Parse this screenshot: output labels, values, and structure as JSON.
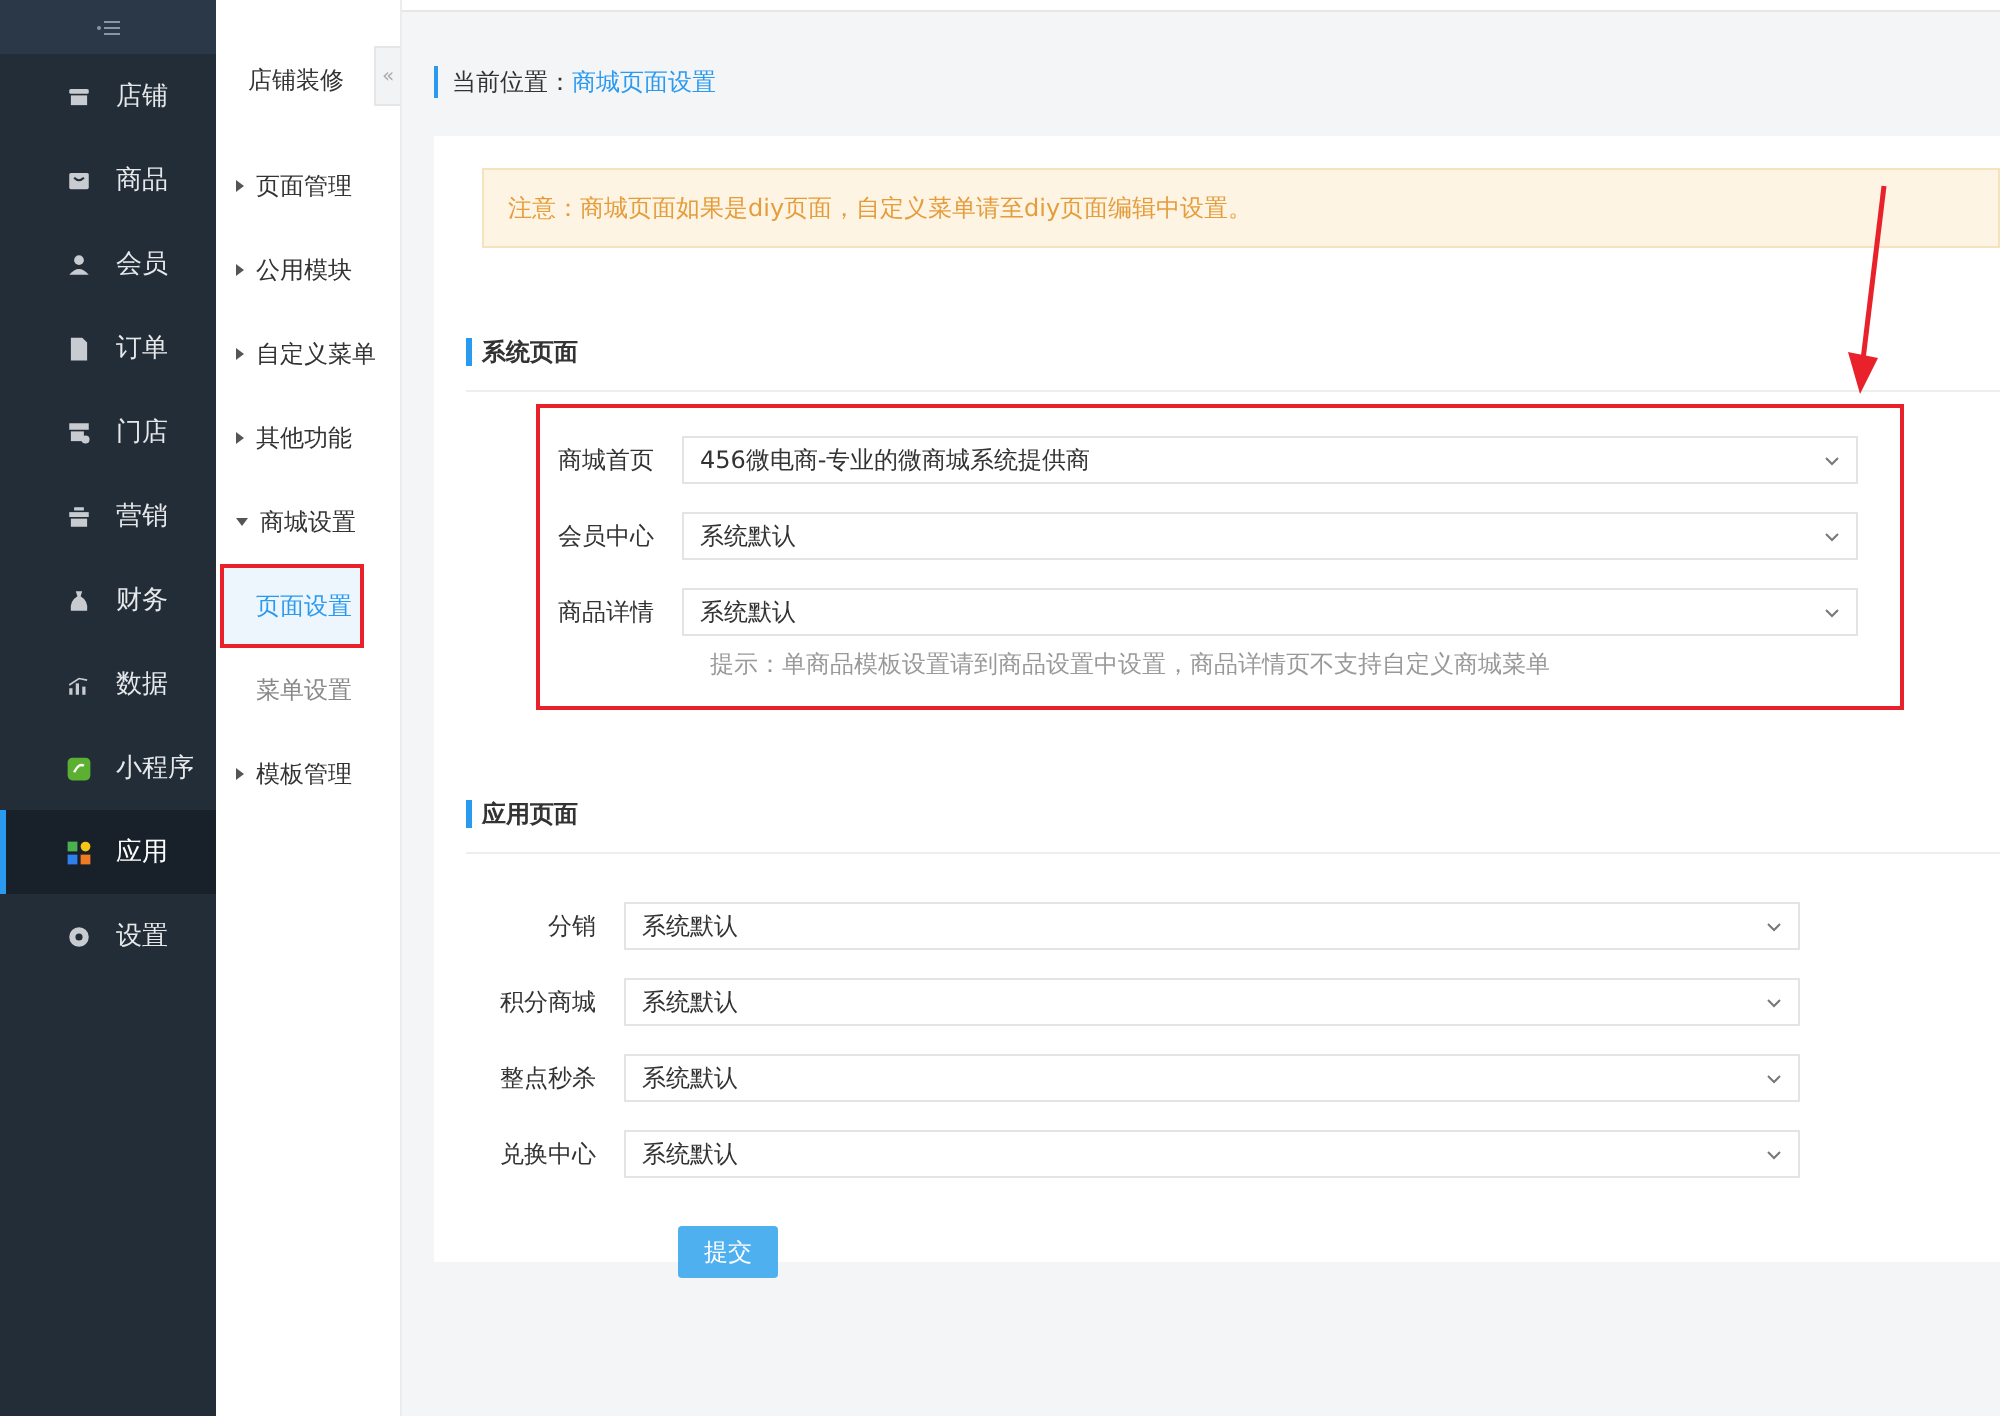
{
  "sidebar": {
    "items": [
      {
        "label": "店铺",
        "selected": false
      },
      {
        "label": "商品",
        "selected": false
      },
      {
        "label": "会员",
        "selected": false
      },
      {
        "label": "订单",
        "selected": false
      },
      {
        "label": "门店",
        "selected": false
      },
      {
        "label": "营销",
        "selected": false
      },
      {
        "label": "财务",
        "selected": false
      },
      {
        "label": "数据",
        "selected": false
      },
      {
        "label": "小程序",
        "selected": false
      },
      {
        "label": "应用",
        "selected": true
      },
      {
        "label": "设置",
        "selected": false
      }
    ]
  },
  "subnav": {
    "title": "店铺装修",
    "collapse": "«",
    "items": [
      {
        "label": "页面管理",
        "expanded": false
      },
      {
        "label": "公用模块",
        "expanded": false
      },
      {
        "label": "自定义菜单",
        "expanded": false
      },
      {
        "label": "其他功能",
        "expanded": false
      },
      {
        "label": "商城设置",
        "expanded": true,
        "children": [
          {
            "label": "页面设置",
            "selected": true,
            "highlighted": true
          },
          {
            "label": "菜单设置",
            "selected": false,
            "highlighted": false
          }
        ]
      },
      {
        "label": "模板管理",
        "expanded": false
      }
    ]
  },
  "breadcrumb": {
    "label": "当前位置：",
    "current": "商城页面设置"
  },
  "notice": "注意：商城页面如果是diy页面，自定义菜单请至diy页面编辑中设置。",
  "sections": [
    {
      "title": "系统页面",
      "highlighted": true,
      "fields": [
        {
          "label": "商城首页",
          "value": "456微电商-专业的微商城系统提供商"
        },
        {
          "label": "会员中心",
          "value": "系统默认"
        },
        {
          "label": "商品详情",
          "value": "系统默认"
        }
      ],
      "hint": "提示：单商品模板设置请到商品设置中设置，商品详情页不支持自定义商城菜单"
    },
    {
      "title": "应用页面",
      "highlighted": false,
      "fields": [
        {
          "label": "分销",
          "value": "系统默认"
        },
        {
          "label": "积分商城",
          "value": "系统默认"
        },
        {
          "label": "整点秒杀",
          "value": "系统默认"
        },
        {
          "label": "兑换中心",
          "value": "系统默认"
        }
      ]
    }
  ],
  "submit": "提交"
}
